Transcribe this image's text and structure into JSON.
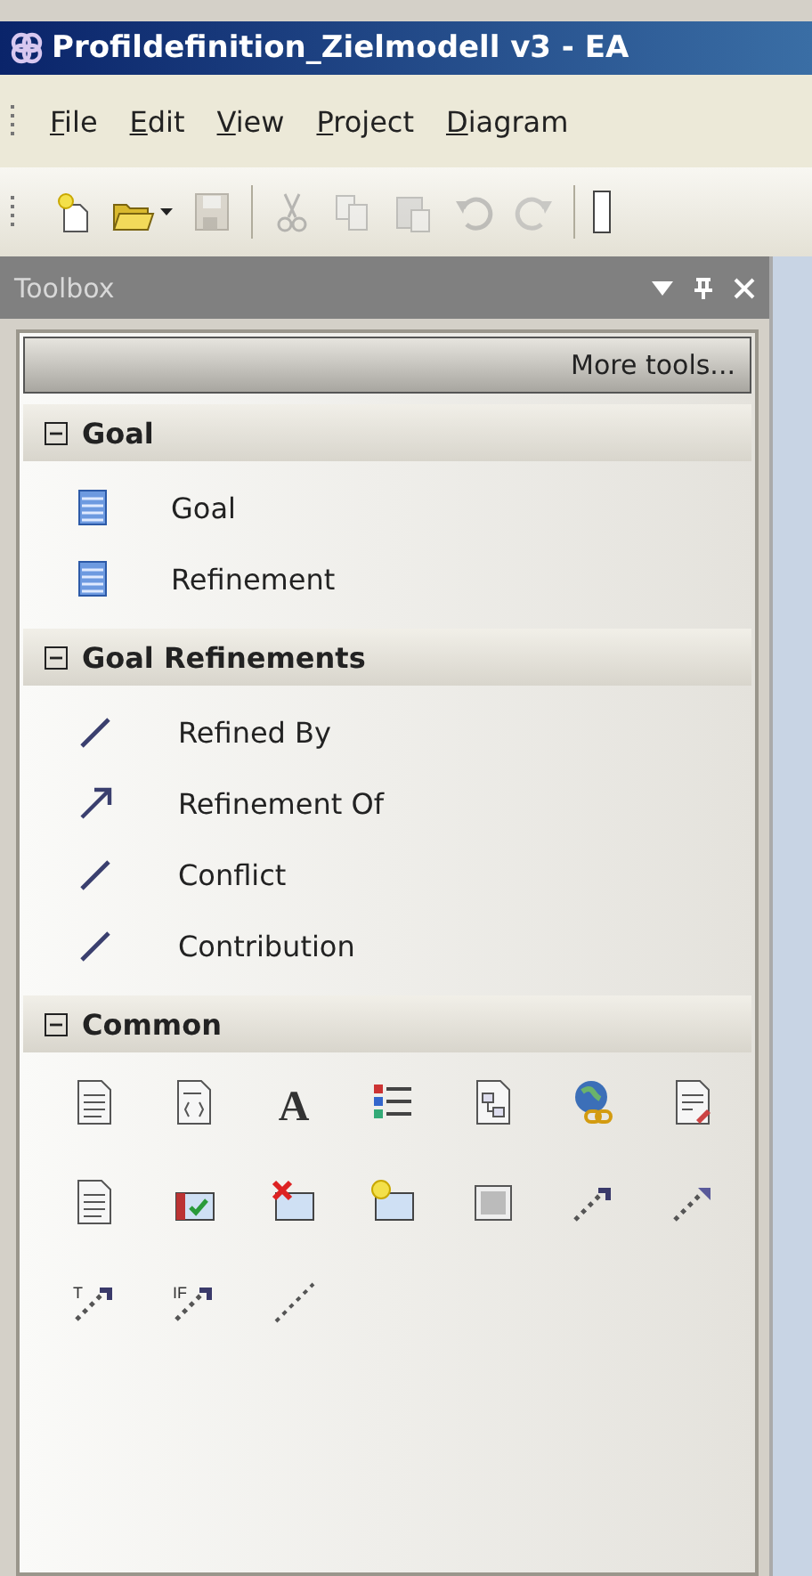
{
  "window": {
    "title": "Profildefinition_Zielmodell v3 - EA"
  },
  "menu": [
    {
      "label": "File",
      "mnemonic_underlined": true
    },
    {
      "label": "Edit",
      "mnemonic_underlined": true
    },
    {
      "label": "View",
      "mnemonic_underlined": true
    },
    {
      "label": "Project",
      "mnemonic_underlined": true
    },
    {
      "label": "Diagram",
      "mnemonic_underlined": true
    }
  ],
  "toolbar": [
    {
      "kind": "new",
      "disabled": false
    },
    {
      "kind": "open",
      "disabled": false
    },
    {
      "kind": "dropdown"
    },
    {
      "kind": "save",
      "disabled": true
    },
    {
      "kind": "sep"
    },
    {
      "kind": "cut",
      "disabled": true
    },
    {
      "kind": "copy",
      "disabled": true
    },
    {
      "kind": "paste",
      "disabled": true
    },
    {
      "kind": "undo",
      "disabled": true
    },
    {
      "kind": "redo",
      "disabled": true
    },
    {
      "kind": "sep"
    }
  ],
  "toolbox": {
    "title": "Toolbox",
    "more_tools": "More tools...",
    "sections": [
      {
        "title": "Goal",
        "expanded": true,
        "items": [
          {
            "label": "Goal",
            "kind": "element"
          },
          {
            "label": "Refinement",
            "kind": "element"
          }
        ]
      },
      {
        "title": "Goal Refinements",
        "expanded": true,
        "items": [
          {
            "label": "Refined By",
            "kind": "line"
          },
          {
            "label": "Refinement Of",
            "kind": "arrow"
          },
          {
            "label": "Conflict",
            "kind": "line"
          },
          {
            "label": "Contribution",
            "kind": "line"
          }
        ]
      },
      {
        "title": "Common",
        "expanded": true,
        "tools": [
          {
            "kind": "doc"
          },
          {
            "kind": "doc-code"
          },
          {
            "kind": "letter",
            "glyph": "A"
          },
          {
            "kind": "list"
          },
          {
            "kind": "doc-diagram"
          },
          {
            "kind": "globe-link"
          },
          {
            "kind": "doc-edit"
          },
          {
            "kind": "doc"
          },
          {
            "kind": "check-window"
          },
          {
            "kind": "delete-window"
          },
          {
            "kind": "new-window"
          },
          {
            "kind": "gradient"
          },
          {
            "kind": "connector"
          },
          {
            "kind": "connector-open"
          },
          {
            "kind": "connector-label",
            "glyph": "T"
          },
          {
            "kind": "connector-label",
            "glyph": "IF"
          },
          {
            "kind": "dotted-line"
          }
        ]
      }
    ]
  }
}
